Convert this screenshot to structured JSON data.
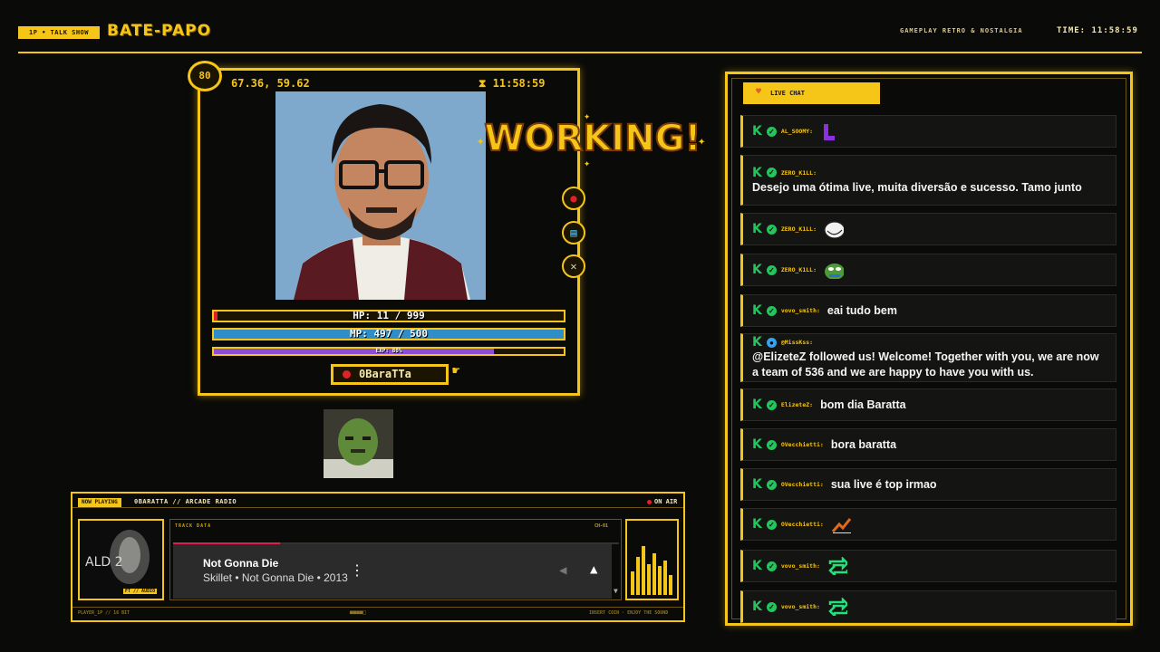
{
  "header": {
    "badge": "1P • TALK SHOW",
    "title": "BATE-PAPO",
    "subtitle": "GAMEPLAY RETRO & NOSTALGIA",
    "time": "TIME: 11:58:59"
  },
  "card": {
    "level": "80",
    "coords": "67.36, 59.62",
    "time": "11:58:59",
    "banner": "WORKING!",
    "hp": "HP: 11 / 999",
    "mp": "MP: 497 / 500",
    "exp": "EXP: 80%",
    "hp_fraction": 0.011,
    "mp_fraction": 0.994,
    "exp_fraction": 0.8,
    "name": "0BaraTTa"
  },
  "music": {
    "badge": "NOW PLAYING",
    "title": "0BARATTA // ARCADE RADIO",
    "on_air": "ON AIR",
    "album_tag": "FT // AUDIO",
    "track_label": "TRACK DATA",
    "track_ch": "CH-01",
    "progress_fraction": 0.24,
    "song_title": "Not Gonna Die",
    "song_meta": "Skillet • Not Gonna Die • 2013",
    "footer_left": "PLAYER_1P // 16 BIT",
    "footer_mid": "■■■■□",
    "footer_right": "INSERT COIN · ENJOY THE SOUND"
  },
  "chat": {
    "tab": "LIVE CHAT",
    "messages": [
      {
        "user": "AL_SOOMY:",
        "text": "",
        "emote": "purple-L"
      },
      {
        "user": "ZERO_K1LL:",
        "text": "Desejo uma ótima live, muita diversão e sucesso. Tamo junto",
        "emote": ""
      },
      {
        "user": "ZERO_K1LL:",
        "text": "",
        "emote": "trollface"
      },
      {
        "user": "ZERO_K1LL:",
        "text": "",
        "emote": "pepe"
      },
      {
        "user": "vovo_smith:",
        "text": "eai tudo bem",
        "emote": ""
      },
      {
        "user": "@MissKss:",
        "text": "@ElizeteZ followed us! Welcome! Together with you, we are now a team of 536 and we are happy to have you with us.",
        "emote": ""
      },
      {
        "user": "ElizeteZ:",
        "text": "bom dia Baratta",
        "emote": ""
      },
      {
        "user": "OVecchietti:",
        "text": "bora baratta",
        "emote": ""
      },
      {
        "user": "OVecchietti:",
        "text": "sua live é top irmao",
        "emote": ""
      },
      {
        "user": "OVecchietti:",
        "text": "",
        "emote": "stonks"
      },
      {
        "user": "vovo_smith:",
        "text": "",
        "emote": "retweet-plus"
      },
      {
        "user": "vovo_smith:",
        "text": "",
        "emote": "retweet-plus"
      }
    ]
  }
}
